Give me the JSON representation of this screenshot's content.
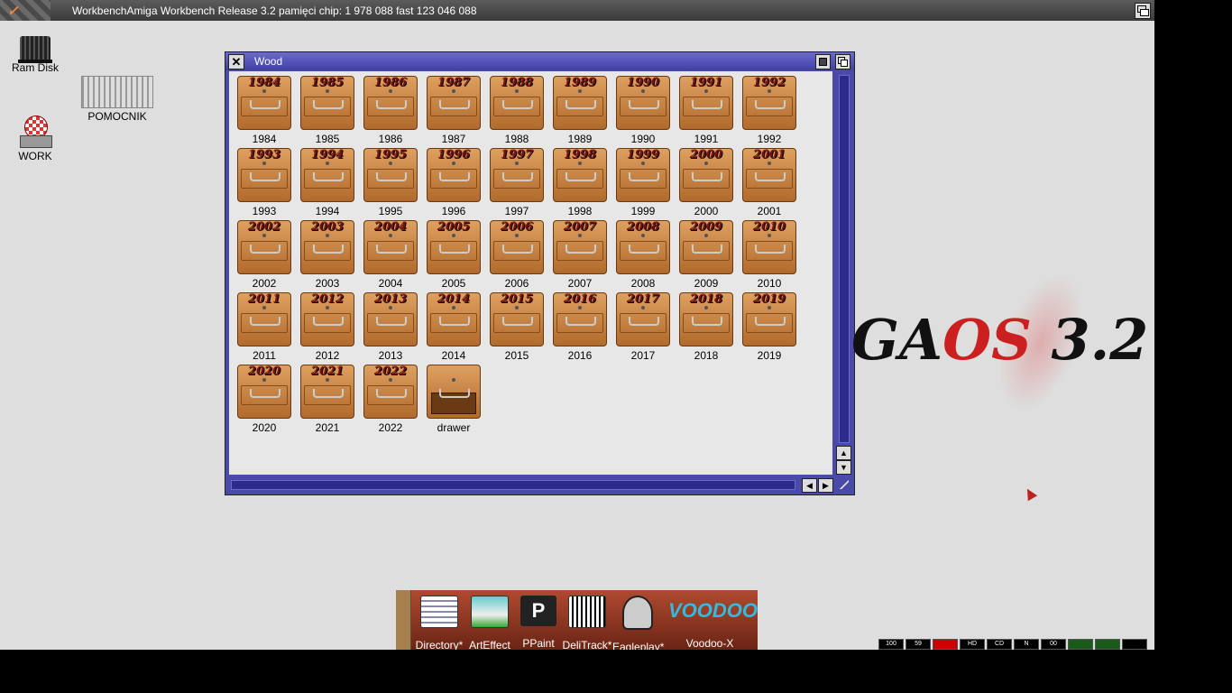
{
  "menubar": {
    "title": "WorkbenchAmiga Workbench Release 3.2  pamięci chip: 1 978 088  fast 123 046 088"
  },
  "desktop": {
    "icons": [
      {
        "label": "Ram Disk"
      },
      {
        "label": "POMOCNIK"
      },
      {
        "label": "WORK"
      }
    ]
  },
  "window": {
    "title": "Wood",
    "close_symbol": "✕",
    "drawers": [
      "1984",
      "1985",
      "1986",
      "1987",
      "1988",
      "1989",
      "1990",
      "1991",
      "1992",
      "1993",
      "1994",
      "1995",
      "1996",
      "1997",
      "1998",
      "1999",
      "2000",
      "2001",
      "2002",
      "2003",
      "2004",
      "2005",
      "2006",
      "2007",
      "2008",
      "2009",
      "2010",
      "2011",
      "2012",
      "2013",
      "2014",
      "2015",
      "2016",
      "2017",
      "2018",
      "2019",
      "2020",
      "2021",
      "2022"
    ],
    "extra_drawer": "drawer",
    "arrows": {
      "up": "▲",
      "down": "▼",
      "left": "◀",
      "right": "▶"
    }
  },
  "logo": {
    "ga": "GA",
    "os": "OS",
    "version": " 3.2"
  },
  "dock": {
    "items": [
      {
        "label": "Directory*"
      },
      {
        "label": "ArtEffect"
      },
      {
        "label": "PPaint",
        "glyph": "P"
      },
      {
        "label": "DeliTrack*"
      },
      {
        "label": "Eagleplay*"
      },
      {
        "label": "Voodoo-X",
        "glyph": "VOODOO"
      }
    ]
  },
  "status_leds": [
    {
      "text": "100",
      "color": "#000000"
    },
    {
      "text": "59",
      "color": "#000000"
    },
    {
      "text": "",
      "color": "#cc0000"
    },
    {
      "text": "HD",
      "color": "#000000"
    },
    {
      "text": "CD",
      "color": "#000000"
    },
    {
      "text": "N",
      "color": "#000000"
    },
    {
      "text": "00",
      "color": "#000000"
    },
    {
      "text": "",
      "color": "#1a5a1a"
    },
    {
      "text": "",
      "color": "#1a5a1a"
    },
    {
      "text": "",
      "color": "#000000"
    }
  ]
}
